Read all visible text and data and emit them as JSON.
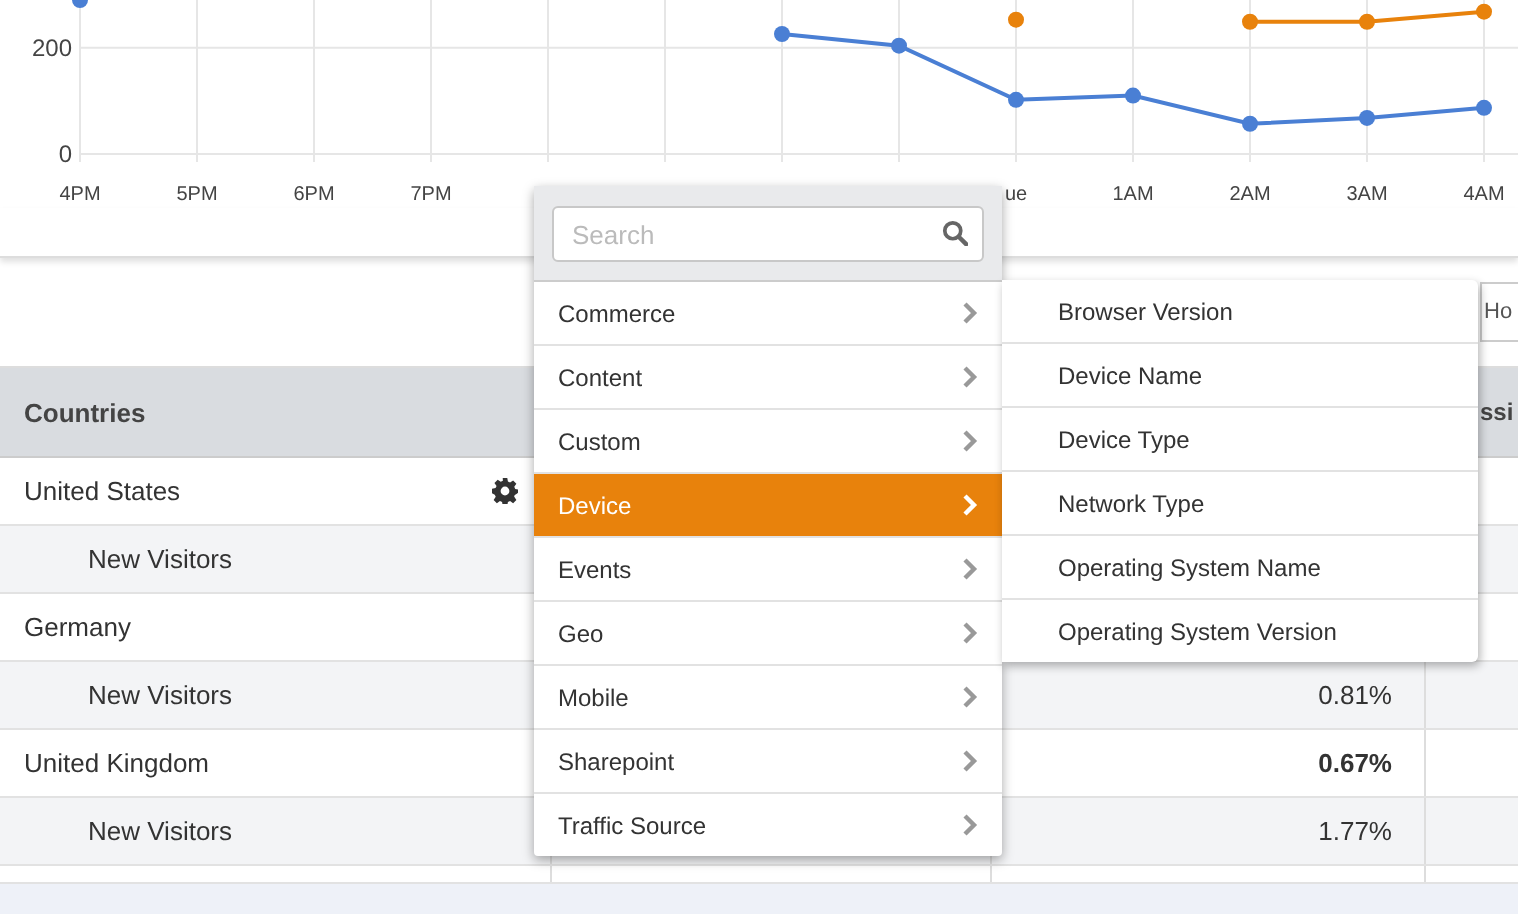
{
  "chart": {
    "chart_data": {
      "type": "line",
      "grid": true,
      "categories": [
        "4PM",
        "5PM",
        "6PM",
        "7PM",
        null,
        null,
        null,
        null,
        "ue",
        "1AM",
        "2AM",
        "3AM",
        "4AM"
      ],
      "ylim": [
        0,
        290
      ],
      "yticks": [
        0,
        200
      ],
      "series": [
        {
          "color": "#4a7fd4",
          "marker": true,
          "values": [
            290,
            null,
            null,
            null,
            null,
            null,
            226,
            204,
            102,
            110,
            57,
            68,
            87
          ]
        },
        {
          "color": "#e8820c",
          "marker": true,
          "values": [
            null,
            null,
            null,
            null,
            null,
            null,
            null,
            null,
            253,
            null,
            249,
            249,
            268
          ]
        }
      ]
    }
  },
  "toolbar": {
    "button": "Ho"
  },
  "table": {
    "header": {
      "column_1": "Countries",
      "column_4": "ssi"
    },
    "rows": [
      {
        "kind": "country",
        "label": "United States",
        "settings": true
      },
      {
        "kind": "segment",
        "label": "New Visitors"
      },
      {
        "kind": "country",
        "label": "Germany"
      },
      {
        "kind": "segment",
        "label": "New Visitors",
        "value": "0.81%"
      },
      {
        "kind": "country",
        "label": "United Kingdom",
        "value": "0.67%"
      },
      {
        "kind": "segment",
        "label": "New Visitors",
        "value": "1.77%"
      },
      {
        "kind": "country"
      }
    ]
  },
  "menu": {
    "search": {
      "placeholder": "Search"
    },
    "items": [
      {
        "label": "Commerce",
        "selected": false
      },
      {
        "label": "Content",
        "selected": false
      },
      {
        "label": "Custom",
        "selected": false
      },
      {
        "label": "Device",
        "selected": true
      },
      {
        "label": "Events",
        "selected": false
      },
      {
        "label": "Geo",
        "selected": false
      },
      {
        "label": "Mobile",
        "selected": false
      },
      {
        "label": "Sharepoint",
        "selected": false
      },
      {
        "label": "Traffic Source",
        "selected": false
      }
    ],
    "submenu": {
      "items": [
        {
          "label": "Browser Version"
        },
        {
          "label": "Device Name"
        },
        {
          "label": "Device Type"
        },
        {
          "label": "Network Type"
        },
        {
          "label": "Operating System Name"
        },
        {
          "label": "Operating System Version"
        }
      ]
    }
  }
}
